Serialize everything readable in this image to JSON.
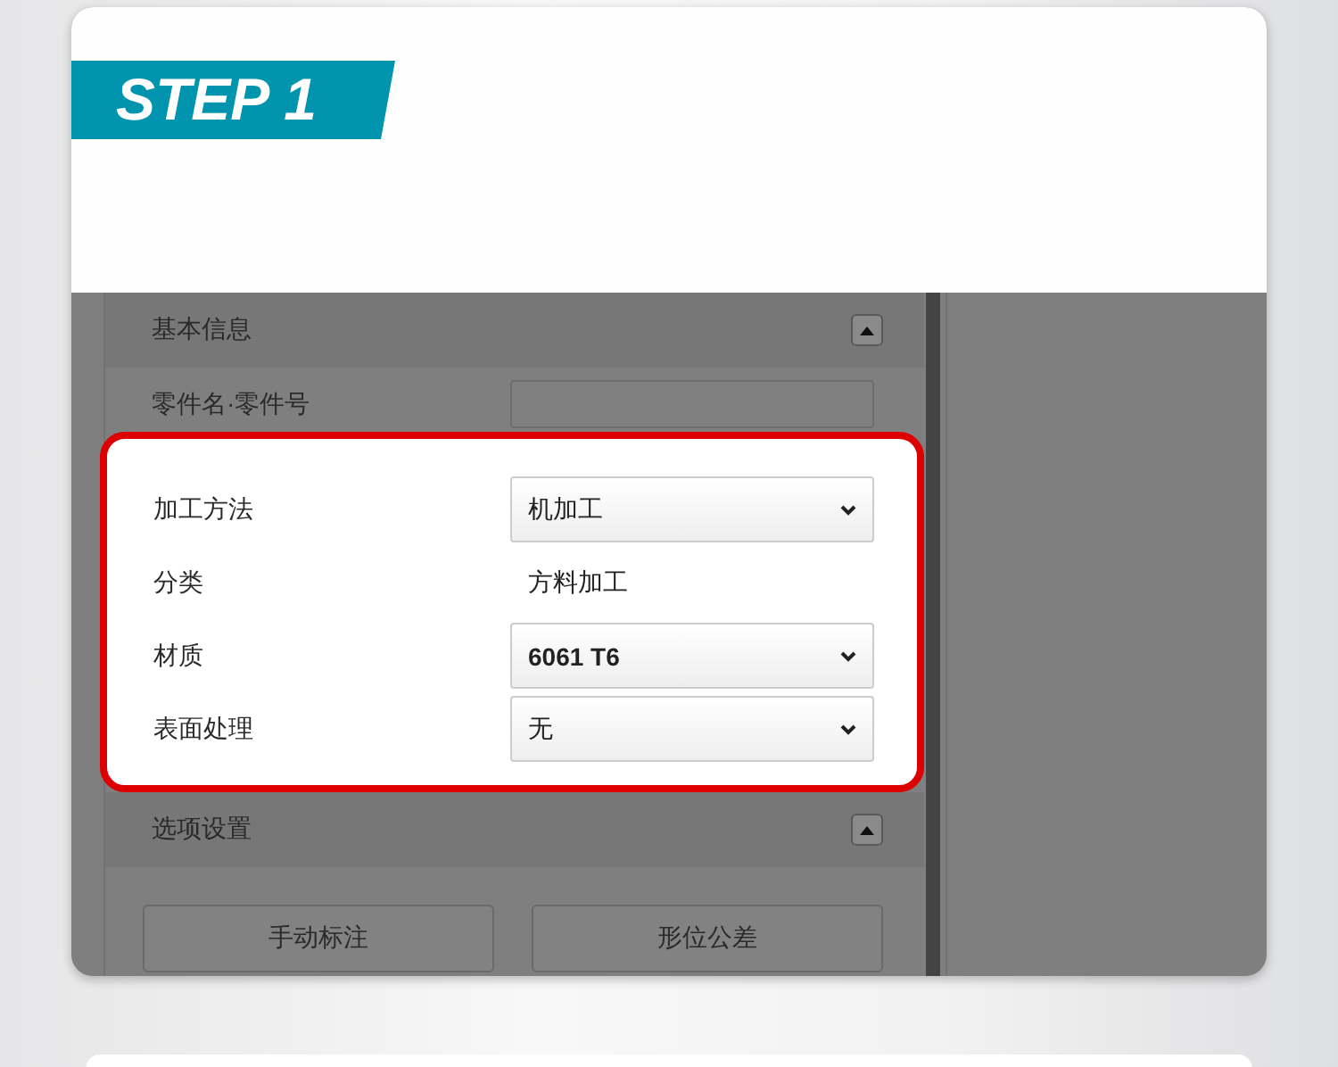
{
  "banner": {
    "label": "STEP 1"
  },
  "basic_info": {
    "title": "基本信息",
    "expanded": true,
    "fields": [
      {
        "kind": "input",
        "label": "零件名·零件号"
      }
    ],
    "highlighted_fields": [
      {
        "kind": "select",
        "label": "加工方法",
        "value": "机加工",
        "bold": false
      },
      {
        "kind": "text",
        "label": "分类",
        "value": "方料加工",
        "bold": false
      },
      {
        "kind": "select",
        "label": "材质",
        "value": "6061 T6",
        "bold": true
      },
      {
        "kind": "select",
        "label": "表面处理",
        "value": "无",
        "bold": false
      }
    ]
  },
  "options": {
    "title": "选项设置",
    "expanded": true,
    "buttons": [
      "手动标注",
      "形位公差"
    ]
  }
}
